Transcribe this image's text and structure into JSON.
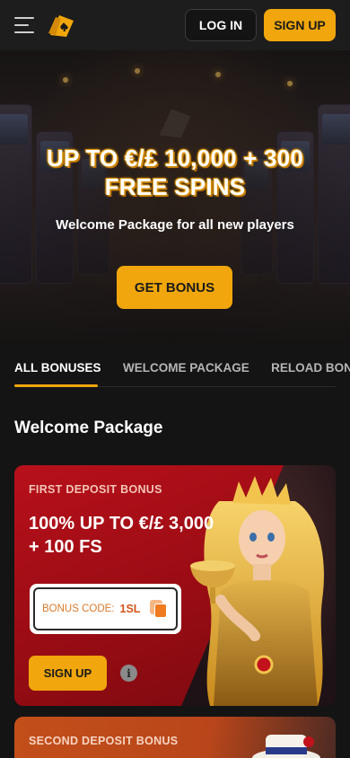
{
  "header": {
    "login_label": "LOG IN",
    "signup_label": "SIGN UP",
    "accent_color": "#f0a60c"
  },
  "hero": {
    "title_line1": "UP TO €/£ 10,000 + 300",
    "title_line2": "FREE SPINS",
    "subtitle": "Welcome Package for all new players",
    "button_label": "GET BONUS"
  },
  "tabs": [
    {
      "label": "ALL BONUSES",
      "active": true
    },
    {
      "label": "WELCOME PACKAGE",
      "active": false
    },
    {
      "label": "RELOAD BONUS",
      "active": false
    }
  ],
  "section": {
    "title": "Welcome Package"
  },
  "cards": [
    {
      "label": "FIRST DEPOSIT BONUS",
      "title": "100% UP TO €/£ 3,000 + 100 FS",
      "code_label": "BONUS CODE:",
      "code_value": "1SL",
      "signup_label": "SIGN UP",
      "info_glyph": "i"
    },
    {
      "label": "SECOND DEPOSIT BONUS"
    }
  ],
  "icons": {
    "menu": "hamburger-icon",
    "logo": "card-logo-icon",
    "copy": "copy-icon",
    "info": "info-icon"
  }
}
